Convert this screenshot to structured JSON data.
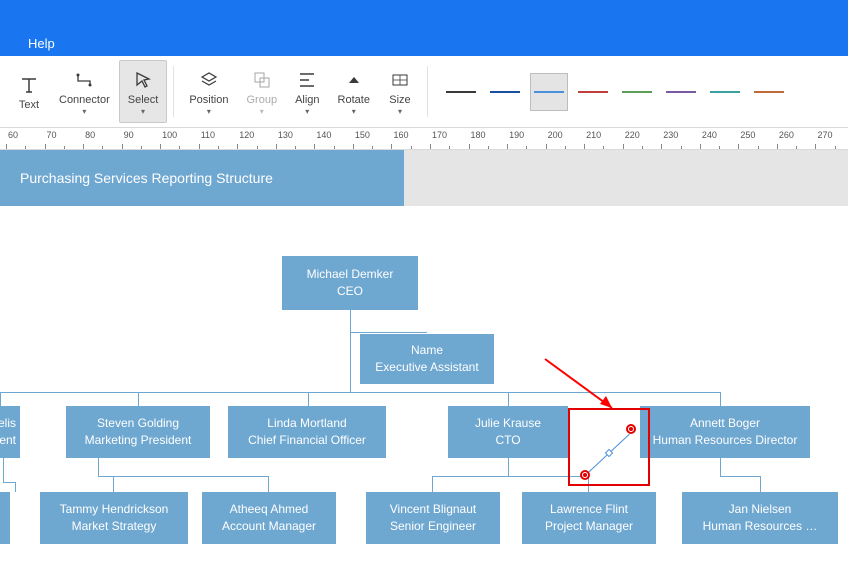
{
  "menu": {
    "help": "Help"
  },
  "ribbon": {
    "text": "Text",
    "connector": "Connector",
    "select": "Select",
    "position": "Position",
    "group": "Group",
    "align": "Align",
    "rotate": "Rotate",
    "size": "Size"
  },
  "line_styles": [
    {
      "color": "#3a3a3a",
      "selected": false
    },
    {
      "color": "#1a4fa0",
      "selected": false
    },
    {
      "color": "#4a90d9",
      "selected": true
    },
    {
      "color": "#c04040",
      "selected": false
    },
    {
      "color": "#5a9e5a",
      "selected": false
    },
    {
      "color": "#7a5aa0",
      "selected": false
    },
    {
      "color": "#3aa0a0",
      "selected": false
    },
    {
      "color": "#c06a3a",
      "selected": false
    }
  ],
  "ruler_start": 60,
  "ruler_end": 270,
  "title_block": "Purchasing Services Reporting Structure",
  "org": {
    "ceo": {
      "name": "Michael Demker",
      "role": "CEO"
    },
    "ea": {
      "name": "Name",
      "role": "Executive Assistant"
    },
    "row1": {
      "c0": {
        "name": "elis",
        "role": "dent"
      },
      "c1": {
        "name": "Steven Golding",
        "role": "Marketing President"
      },
      "c2": {
        "name": "Linda Mortland",
        "role": "Chief Financial Officer"
      },
      "c3": {
        "name": "Julie Krause",
        "role": "CTO"
      },
      "c4": {
        "name": "Annett Boger",
        "role": "Human Resources Director"
      }
    },
    "row2": {
      "d0": {
        "name": "",
        "role": ""
      },
      "d1": {
        "name": "Tammy Hendrickson",
        "role": "Market Strategy"
      },
      "d2": {
        "name": "Atheeq Ahmed",
        "role": "Account Manager"
      },
      "d3": {
        "name": "Vincent Blignaut",
        "role": "Senior Engineer"
      },
      "d4": {
        "name": "Lawrence Flint",
        "role": "Project Manager"
      },
      "d5": {
        "name": "Jan Nielsen",
        "role": "Human Resources …"
      }
    }
  }
}
